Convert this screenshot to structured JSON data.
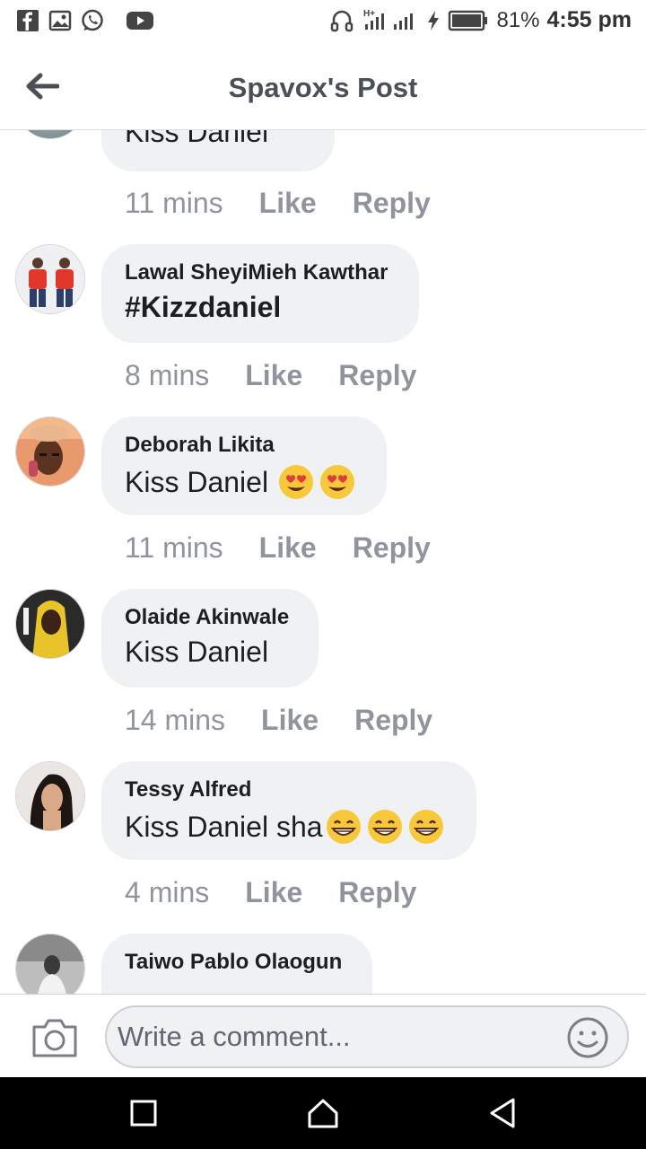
{
  "status_bar": {
    "network": "H+",
    "battery": "81%",
    "time": "4:55 pm",
    "left_icons": [
      "facebook-icon",
      "gallery-icon",
      "whatsapp-icon",
      "youtube-icon"
    ],
    "right_icons": [
      "headset-icon",
      "signal-icon",
      "charging-icon",
      "battery-icon"
    ]
  },
  "header": {
    "title": "Spavox's Post",
    "back_icon": "back-arrow-icon"
  },
  "comments": [
    {
      "author": "",
      "text": "Kiss Daniel",
      "time": "11 mins",
      "like": "Like",
      "reply": "Reply",
      "partial": true
    },
    {
      "author": "Lawal SheyiMieh Kawthar",
      "text": "#Kizzdaniel",
      "time": "8 mins",
      "like": "Like",
      "reply": "Reply"
    },
    {
      "author": "Deborah Likita",
      "text": "Kiss Daniel",
      "emoji": [
        "heart-eyes-emoji",
        "heart-eyes-emoji"
      ],
      "time": "11 mins",
      "like": "Like",
      "reply": "Reply"
    },
    {
      "author": "Olaide Akinwale",
      "text": "Kiss Daniel",
      "time": "14 mins",
      "like": "Like",
      "reply": "Reply"
    },
    {
      "author": "Tessy Alfred",
      "text": "Kiss Daniel sha",
      "emoji": [
        "grinning-emoji",
        "grinning-emoji",
        "grinning-emoji"
      ],
      "time": "4 mins",
      "like": "Like",
      "reply": "Reply"
    },
    {
      "author": "Taiwo Pablo Olaogun",
      "text": "",
      "partial": true
    }
  ],
  "composer": {
    "placeholder": "Write a comment...",
    "camera_icon": "camera-icon",
    "emoji_icon": "smiley-icon"
  },
  "navbar": {
    "icons": [
      "recents-icon",
      "home-icon",
      "back-icon"
    ]
  },
  "colors": {
    "bubble": "#f0f1f3",
    "meta_text": "#90949c",
    "title_text": "#4b4f56"
  }
}
